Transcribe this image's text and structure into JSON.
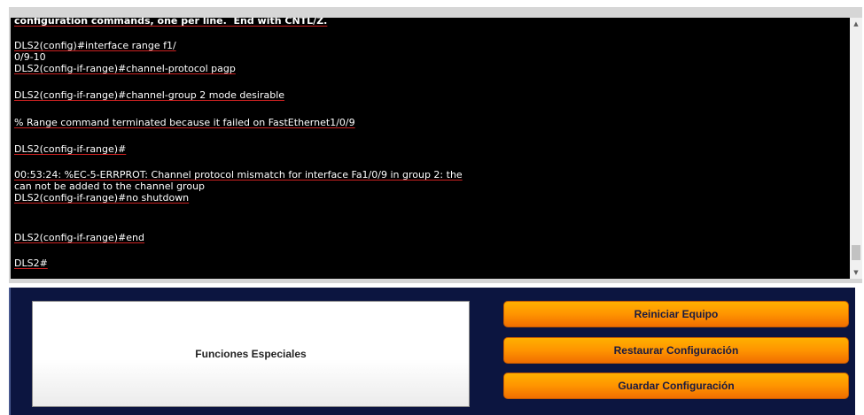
{
  "terminal": {
    "lines": [
      "configuration commands, one per line.  End with CNTL/Z.",
      "DLS2(config)#interface range f1/",
      "0/9-10",
      "DLS2(config-if-range)#channel-protocol pagp",
      "DLS2(config-if-range)#channel-group 2 mode desirable",
      "% Range command terminated because it failed on FastEthernet1/0/9",
      "DLS2(config-if-range)#",
      "00:53:24: %EC-5-ERRPROT: Channel protocol mismatch for interface Fa1/0/9 in group 2: the",
      "can not be added to the channel group",
      "DLS2(config-if-range)#no shutdown",
      "DLS2(config-if-range)#end",
      "DLS2#"
    ]
  },
  "scrollbar": {
    "up_icon": "▲",
    "down_icon": "▼"
  },
  "panel": {
    "special_label": "Funciones Especiales",
    "buttons": {
      "restart": "Reiniciar Equipo",
      "restore": "Restaurar Configuración",
      "save": "Guardar Configuración"
    }
  },
  "colors": {
    "terminal_bg": "#000000",
    "terminal_text": "#ffffff",
    "underline": "#cc2222",
    "panel_bg": "#0c1540",
    "button_orange": "#ff9400"
  }
}
